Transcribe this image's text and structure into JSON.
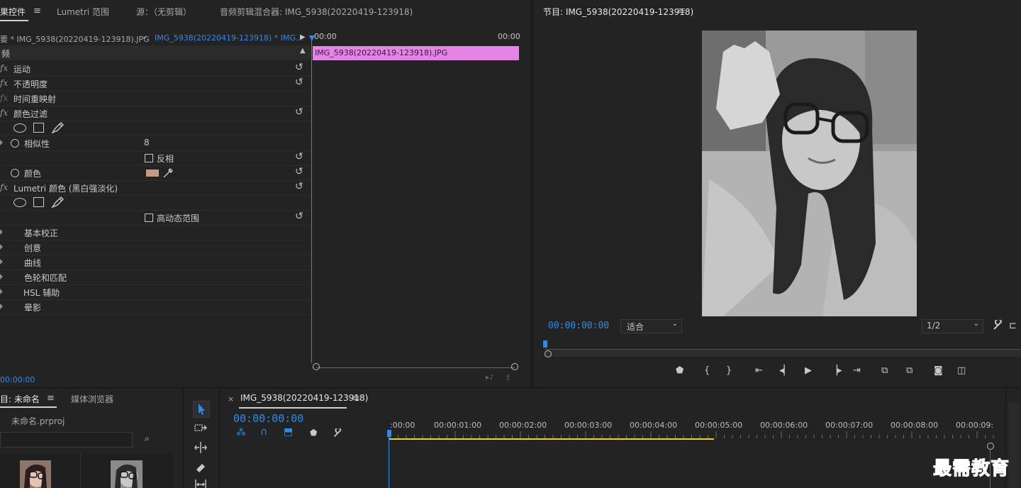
{
  "effect_controls": {
    "tab_label": "果控件",
    "tab_lumetri": "Lumetri 范围",
    "tab_source": "源：（无剪辑）",
    "tab_audio_mixer": "音频剪辑混合器: IMG_5938(20220419-123918)",
    "clip_master": "要 * IMG_5938(20220419-123918).JPG",
    "clip_sequence": "IMG_5938(20220419-123918) * IMG...",
    "timeline_start": "00:00",
    "timeline_end": "00:00",
    "clip_name": "IMG_5938(20220419-123918).JPG",
    "section_video": "频",
    "rows": {
      "motion": "运动",
      "opacity": "不透明度",
      "time_remap": "时间重映射",
      "color_filter": "颜色过滤",
      "similarity": "相似性",
      "similarity_value": "8",
      "invert": "反相",
      "color": "颜色",
      "lumetri": "Lumetri 颜色 (黑白强淡化)",
      "hdr": "高动态范围",
      "basic": "基本校正",
      "creative": "创意",
      "curves": "曲线",
      "color_wheels": "色轮和匹配",
      "hsl": "HSL 辅助",
      "vignette": "晕影"
    },
    "timecode": "00:00:00",
    "colors": {
      "swatch": "#c79a86",
      "clip": "#e484e4",
      "accent": "#2d8ceb"
    }
  },
  "program_monitor": {
    "title": "节目: IMG_5938(20220419-123918)",
    "timecode": "00:00:00:00",
    "fit_label": "适合",
    "resolution": "1/2"
  },
  "project": {
    "tab_label": "目: 未命名",
    "tab_media": "媒体浏览器",
    "file_name": "未命名.prproj"
  },
  "timeline": {
    "tab_label": "IMG_5938(20220419-123918)",
    "close_glyph": "×",
    "timecode": "00:00:00:00",
    "ruler": [
      ":00:00",
      "00:00:01:00",
      "00:00:02:00",
      "00:00:03:00",
      "00:00:04:00",
      "00:00:05:00",
      "00:00:06:00",
      "00:00:07:00",
      "00:00:08:00",
      "00:00:09:"
    ]
  },
  "watermark": "最需教育"
}
